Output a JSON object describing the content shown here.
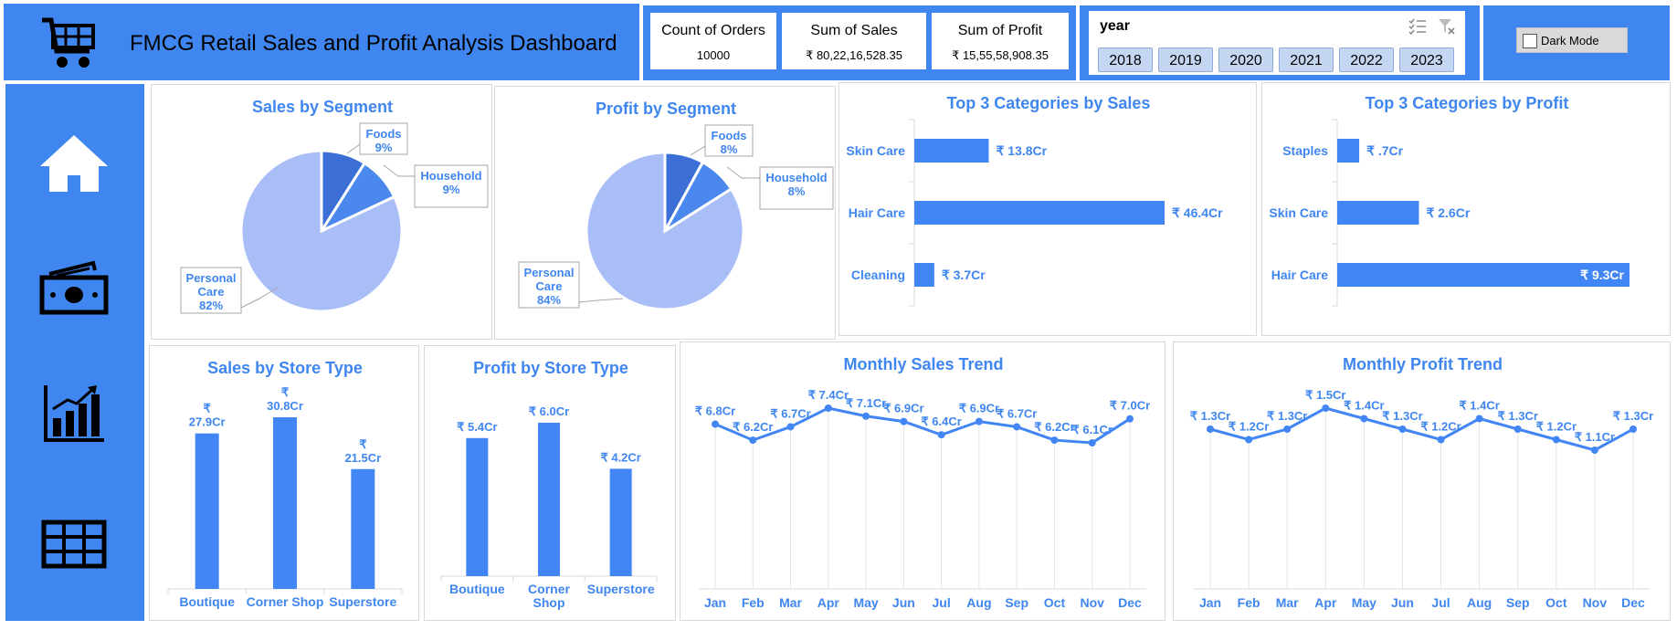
{
  "header": {
    "title": "FMCG Retail Sales and Profit Analysis Dashboard",
    "cart_icon": "shopping-cart-icon"
  },
  "kpis": [
    {
      "label": "Count of Orders",
      "value": "10000"
    },
    {
      "label": "Sum of Sales",
      "value": "₹ 80,22,16,528.35"
    },
    {
      "label": "Sum of Profit",
      "value": "₹ 15,55,58,908.35"
    }
  ],
  "slicer": {
    "header": "year",
    "multiselect_icon": "multi-select-icon",
    "clear_filter_icon": "clear-filter-icon",
    "years": [
      "2018",
      "2019",
      "2020",
      "2021",
      "2022",
      "2023"
    ]
  },
  "dark_mode": {
    "label": "Dark Mode",
    "checked": false
  },
  "sidebar": {
    "icons": [
      "home-icon",
      "cash-icon",
      "chart-icon",
      "table-icon"
    ]
  },
  "colors": {
    "accent": "#3f86f0",
    "pie_light": "#a9bdf7",
    "pie_mid": "#4a88ee",
    "pie_dark": "#3b6fd6",
    "bar": "#4285f4"
  },
  "chart_data": [
    {
      "id": "sales-by-segment",
      "type": "pie",
      "title": "Sales by Segment",
      "slices": [
        {
          "name": "Personal Care",
          "pct": 82,
          "label": "Personal Care 82%"
        },
        {
          "name": "Foods",
          "pct": 9,
          "label": "Foods 9%"
        },
        {
          "name": "Household",
          "pct": 9,
          "label": "Household 9%"
        }
      ]
    },
    {
      "id": "profit-by-segment",
      "type": "pie",
      "title": "Profit by Segment",
      "slices": [
        {
          "name": "Personal Care",
          "pct": 84,
          "label": "Personal Care 84%"
        },
        {
          "name": "Foods",
          "pct": 8,
          "label": "Foods 8%"
        },
        {
          "name": "Household",
          "pct": 8,
          "label": "Household 8%"
        }
      ]
    },
    {
      "id": "top3-sales",
      "type": "bar",
      "orientation": "horizontal",
      "title": "Top 3 Categories by Sales",
      "categories": [
        "Skin Care",
        "Hair Care",
        "Cleaning"
      ],
      "values": [
        13.8,
        46.4,
        3.7
      ],
      "labels": [
        "₹ 13.8Cr",
        "₹ 46.4Cr",
        "₹ 3.7Cr"
      ]
    },
    {
      "id": "top3-profit",
      "type": "bar",
      "orientation": "horizontal",
      "title": "Top 3 Categories by Profit",
      "categories": [
        "Staples",
        "Skin Care",
        "Hair Care"
      ],
      "values": [
        0.7,
        2.6,
        9.3
      ],
      "labels": [
        "₹ .7Cr",
        "₹ 2.6Cr",
        "₹ 9.3Cr"
      ]
    },
    {
      "id": "sales-by-store",
      "type": "bar",
      "title": "Sales by Store Type",
      "categories": [
        "Boutique",
        "Corner Shop",
        "Superstore"
      ],
      "values": [
        27.9,
        30.8,
        21.5
      ],
      "labels": [
        "₹ 27.9Cr",
        "₹ 30.8Cr",
        "₹ 21.5Cr"
      ]
    },
    {
      "id": "profit-by-store",
      "type": "bar",
      "title": "Profit by Store Type",
      "categories": [
        "Boutique",
        "Corner Shop",
        "Superstore"
      ],
      "values": [
        5.4,
        6.0,
        4.2
      ],
      "labels": [
        "₹ 5.4Cr",
        "₹ 6.0Cr",
        "₹ 4.2Cr"
      ]
    },
    {
      "id": "monthly-sales",
      "type": "line",
      "title": "Monthly Sales Trend",
      "x": [
        "Jan",
        "Feb",
        "Mar",
        "Apr",
        "May",
        "Jun",
        "Jul",
        "Aug",
        "Sep",
        "Oct",
        "Nov",
        "Dec"
      ],
      "values": [
        6.8,
        6.2,
        6.7,
        7.4,
        7.1,
        6.9,
        6.4,
        6.9,
        6.7,
        6.2,
        6.1,
        7.0
      ],
      "labels": [
        "₹ 6.8Cr",
        "₹ 6.2Cr",
        "₹ 6.7Cr",
        "₹ 7.4Cr",
        "₹ 7.1Cr",
        "₹ 6.9Cr",
        "₹ 6.4Cr",
        "₹ 6.9Cr",
        "₹ 6.7Cr",
        "₹ 6.2Cr",
        "₹ 6.1Cr",
        "₹ 7.0Cr"
      ]
    },
    {
      "id": "monthly-profit",
      "type": "line",
      "title": "Monthly Profit Trend",
      "x": [
        "Jan",
        "Feb",
        "Mar",
        "Apr",
        "May",
        "Jun",
        "Jul",
        "Aug",
        "Sep",
        "Oct",
        "Nov",
        "Dec"
      ],
      "values": [
        1.3,
        1.2,
        1.3,
        1.5,
        1.4,
        1.3,
        1.2,
        1.4,
        1.3,
        1.2,
        1.1,
        1.3
      ],
      "labels": [
        "₹ 1.3Cr",
        "₹ 1.2Cr",
        "₹ 1.3Cr",
        "₹ 1.5Cr",
        "₹ 1.4Cr",
        "₹ 1.3Cr",
        "₹ 1.2Cr",
        "₹ 1.4Cr",
        "₹ 1.3Cr",
        "₹ 1.2Cr",
        "₹ 1.1Cr",
        "₹ 1.3Cr"
      ]
    }
  ]
}
